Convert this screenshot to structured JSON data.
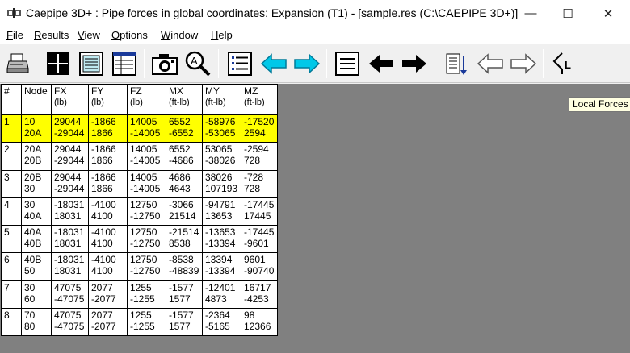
{
  "window": {
    "title": "Caepipe 3D+ : Pipe forces in global coordinates: Expansion (T1) -   [sample.res (C:\\CAEPIPE 3D+)]",
    "minimize_glyph": "—",
    "maximize_glyph": "☐",
    "close_glyph": "✕"
  },
  "menu": [
    {
      "u": "F",
      "rest": "ile"
    },
    {
      "u": "R",
      "rest": "esults"
    },
    {
      "u": "V",
      "rest": "iew"
    },
    {
      "u": "O",
      "rest": "ptions"
    },
    {
      "u": "W",
      "rest": "indow"
    },
    {
      "u": "H",
      "rest": "elp"
    }
  ],
  "toolbar": {
    "icons": [
      "printer-icon",
      "grid-icon",
      "text-report-icon",
      "table-view-icon",
      "camera-icon",
      "zoom-icon",
      "list-icon",
      "arrow-left-icon",
      "arrow-right-icon",
      "lines-icon",
      "black-arrow-left-icon",
      "black-arrow-right-icon",
      "sort-down-icon",
      "outline-arrow-left-icon",
      "outline-arrow-right-icon",
      "local-forces-icon"
    ],
    "tooltip": "Local Forces"
  },
  "table": {
    "headers": [
      {
        "name": "#",
        "unit": ""
      },
      {
        "name": "Node",
        "unit": ""
      },
      {
        "name": "FX",
        "unit": "(lb)"
      },
      {
        "name": "FY",
        "unit": "(lb)"
      },
      {
        "name": "FZ",
        "unit": "(lb)"
      },
      {
        "name": "MX",
        "unit": "(ft-lb)"
      },
      {
        "name": "MY",
        "unit": "(ft-lb)"
      },
      {
        "name": "MZ",
        "unit": "(ft-lb)"
      }
    ],
    "rows": [
      {
        "id": "1",
        "selected": true,
        "cells": [
          [
            "10",
            "20A"
          ],
          [
            "29044",
            "-29044"
          ],
          [
            "-1866",
            "1866"
          ],
          [
            "14005",
            "-14005"
          ],
          [
            "6552",
            "-6552"
          ],
          [
            "-58976",
            "-53065"
          ],
          [
            "-17520",
            "2594"
          ]
        ]
      },
      {
        "id": "2",
        "selected": false,
        "cells": [
          [
            "20A",
            "20B"
          ],
          [
            "29044",
            "-29044"
          ],
          [
            "-1866",
            "1866"
          ],
          [
            "14005",
            "-14005"
          ],
          [
            "6552",
            "-4686"
          ],
          [
            "53065",
            "-38026"
          ],
          [
            "-2594",
            "728"
          ]
        ]
      },
      {
        "id": "3",
        "selected": false,
        "cells": [
          [
            "20B",
            "30"
          ],
          [
            "29044",
            "-29044"
          ],
          [
            "-1866",
            "1866"
          ],
          [
            "14005",
            "-14005"
          ],
          [
            "4686",
            "4643"
          ],
          [
            "38026",
            "107193"
          ],
          [
            "-728",
            "728"
          ]
        ]
      },
      {
        "id": "4",
        "selected": false,
        "cells": [
          [
            "30",
            "40A"
          ],
          [
            "-18031",
            "18031"
          ],
          [
            "-4100",
            "4100"
          ],
          [
            "12750",
            "-12750"
          ],
          [
            "-3066",
            "21514"
          ],
          [
            "-94791",
            "13653"
          ],
          [
            "-17445",
            "17445"
          ]
        ]
      },
      {
        "id": "5",
        "selected": false,
        "cells": [
          [
            "40A",
            "40B"
          ],
          [
            "-18031",
            "18031"
          ],
          [
            "-4100",
            "4100"
          ],
          [
            "12750",
            "-12750"
          ],
          [
            "-21514",
            "8538"
          ],
          [
            "-13653",
            "-13394"
          ],
          [
            "-17445",
            "-9601"
          ]
        ]
      },
      {
        "id": "6",
        "selected": false,
        "cells": [
          [
            "40B",
            "50"
          ],
          [
            "-18031",
            "18031"
          ],
          [
            "-4100",
            "4100"
          ],
          [
            "12750",
            "-12750"
          ],
          [
            "-8538",
            "-48839"
          ],
          [
            "13394",
            "-13394"
          ],
          [
            "9601",
            "-90740"
          ]
        ]
      },
      {
        "id": "7",
        "selected": false,
        "cells": [
          [
            "30",
            "60"
          ],
          [
            "47075",
            "-47075"
          ],
          [
            "2077",
            "-2077"
          ],
          [
            "1255",
            "-1255"
          ],
          [
            "-1577",
            "1577"
          ],
          [
            "-12401",
            "4873"
          ],
          [
            "16717",
            "-4253"
          ]
        ]
      },
      {
        "id": "8",
        "selected": false,
        "cells": [
          [
            "70",
            "80"
          ],
          [
            "47075",
            "-47075"
          ],
          [
            "2077",
            "-2077"
          ],
          [
            "1255",
            "-1255"
          ],
          [
            "-1577",
            "1577"
          ],
          [
            "-2364",
            "-5165"
          ],
          [
            "98",
            "12366"
          ]
        ]
      }
    ]
  },
  "colors": {
    "selected_row": "#ffff00",
    "arrow_cyan": "#00c8e8",
    "workspace": "#808080"
  }
}
